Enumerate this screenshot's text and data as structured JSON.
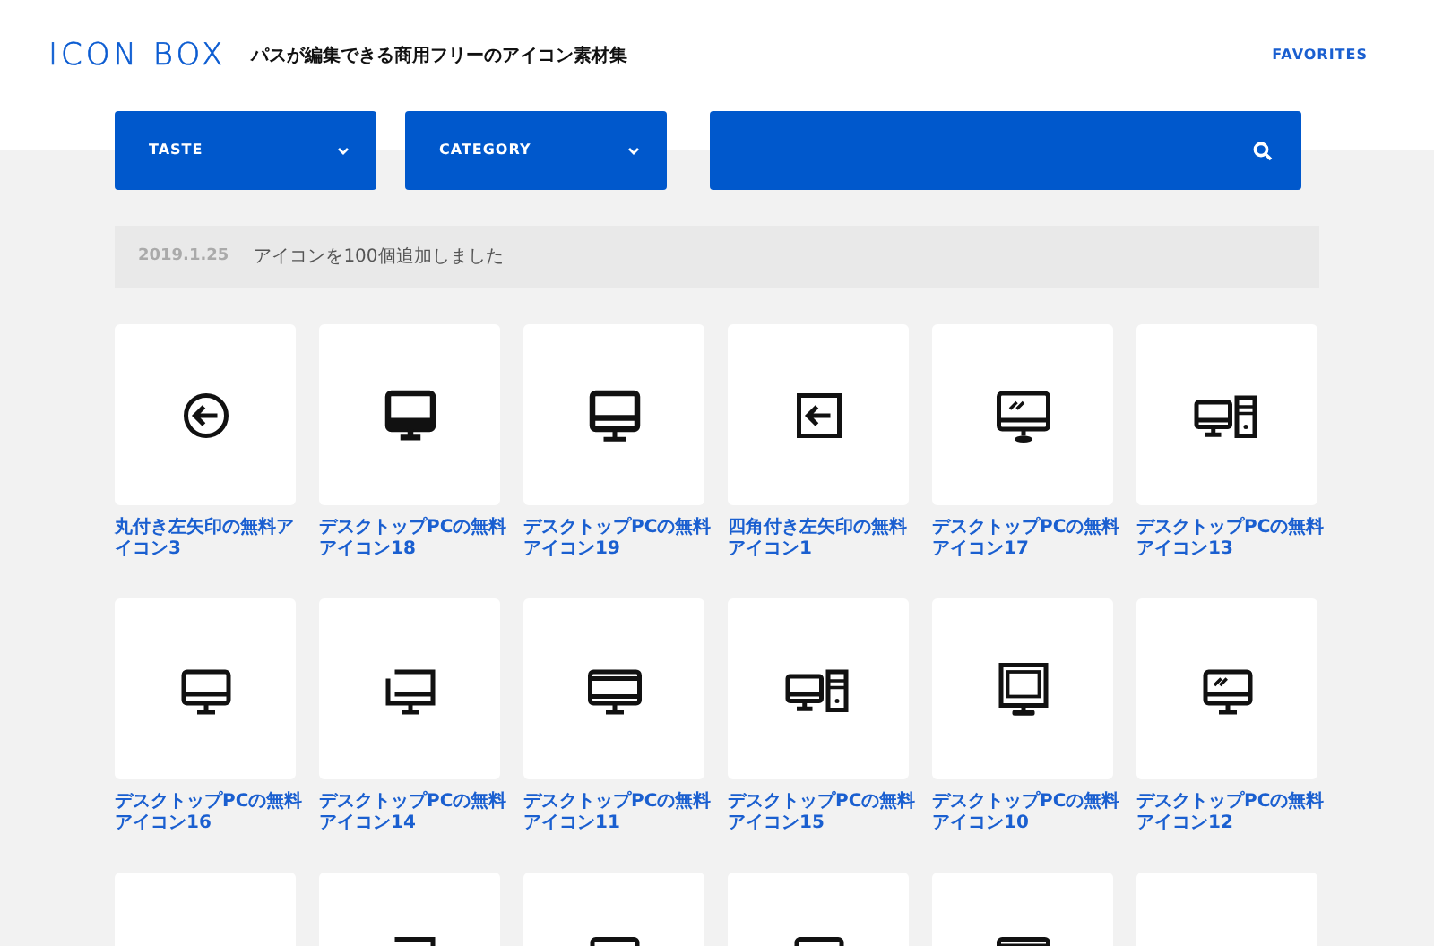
{
  "header": {
    "logo": "ICON BOX",
    "tagline": "パスが編集できる商用フリーのアイコン素材集",
    "nav": [
      {
        "label": "FAVORITES"
      }
    ]
  },
  "filters": [
    {
      "label": "TASTE"
    },
    {
      "label": "CATEGORY"
    }
  ],
  "news": {
    "date": "2019.1.25",
    "text": "アイコンを100個追加しました"
  },
  "icons": [
    {
      "title": "丸付き左矢印の無料アイコン3",
      "kind": "circle-arrow"
    },
    {
      "title": "デスクトップPCの無料アイコン18",
      "kind": "monitor-solid"
    },
    {
      "title": "デスクトップPCの無料アイコン19",
      "kind": "monitor-solid-bar"
    },
    {
      "title": "四角付き左矢印の無料アイコン1",
      "kind": "square-arrow"
    },
    {
      "title": "デスクトップPCの無料アイコン17",
      "kind": "monitor-glare-base"
    },
    {
      "title": "デスクトップPCの無料アイコン13",
      "kind": "desktop-tower"
    },
    {
      "title": "デスクトップPCの無料アイコン16",
      "kind": "monitor"
    },
    {
      "title": "デスクトップPCの無料アイコン14",
      "kind": "monitor-corner"
    },
    {
      "title": "デスクトップPCの無料アイコン11",
      "kind": "monitor-bezel"
    },
    {
      "title": "デスクトップPCの無料アイコン15",
      "kind": "desktop-tower"
    },
    {
      "title": "デスクトップPCの無料アイコン10",
      "kind": "monitor-crt"
    },
    {
      "title": "デスクトップPCの無料アイコン12",
      "kind": "monitor-glare"
    },
    {
      "kind": "blank"
    },
    {
      "kind": "monitor-corner",
      "partial": true
    },
    {
      "kind": "monitor",
      "partial": true
    },
    {
      "kind": "monitor",
      "partial": true
    },
    {
      "kind": "monitor-bezel",
      "partial": true
    },
    {
      "kind": "blank"
    }
  ]
}
